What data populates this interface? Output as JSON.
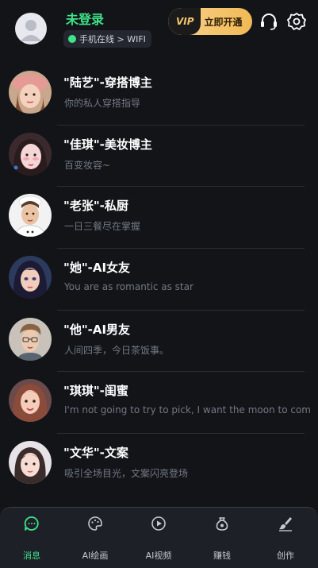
{
  "header": {
    "login_title": "未登录",
    "status": "手机在线 > WIFI",
    "vip_tag": "VIP",
    "vip_label": "立即开通"
  },
  "chats": [
    {
      "title": "\"陆艺\"-穿搭博主",
      "subtitle": "你的私人穿搭指导"
    },
    {
      "title": "\"佳琪\"-美妆博主",
      "subtitle": "百变妆容~"
    },
    {
      "title": "\"老张\"-私厨",
      "subtitle": "一日三餐尽在掌握"
    },
    {
      "title": "\"她\"-AI女友",
      "subtitle": "You are as romantic as star"
    },
    {
      "title": "\"他\"-AI男友",
      "subtitle": "人间四季，今日茶饭事。"
    },
    {
      "title": "\"琪琪\"-闺蜜",
      "subtitle": "I'm not going to try to pick, I want the moon to come t..."
    },
    {
      "title": "\"文华\"-文案",
      "subtitle": "吸引全场目光，文案闪亮登场"
    }
  ],
  "tabs": [
    {
      "label": "消息",
      "icon": "chat-icon",
      "active": true
    },
    {
      "label": "AI绘画",
      "icon": "palette-icon",
      "active": false
    },
    {
      "label": "AI视频",
      "icon": "play-icon",
      "active": false
    },
    {
      "label": "赚钱",
      "icon": "money-bag-icon",
      "active": false
    },
    {
      "label": "创作",
      "icon": "brush-icon",
      "active": false
    }
  ],
  "colors": {
    "accent": "#3ee38a",
    "background": "#121418",
    "vip_gold": "#f3c66c"
  }
}
